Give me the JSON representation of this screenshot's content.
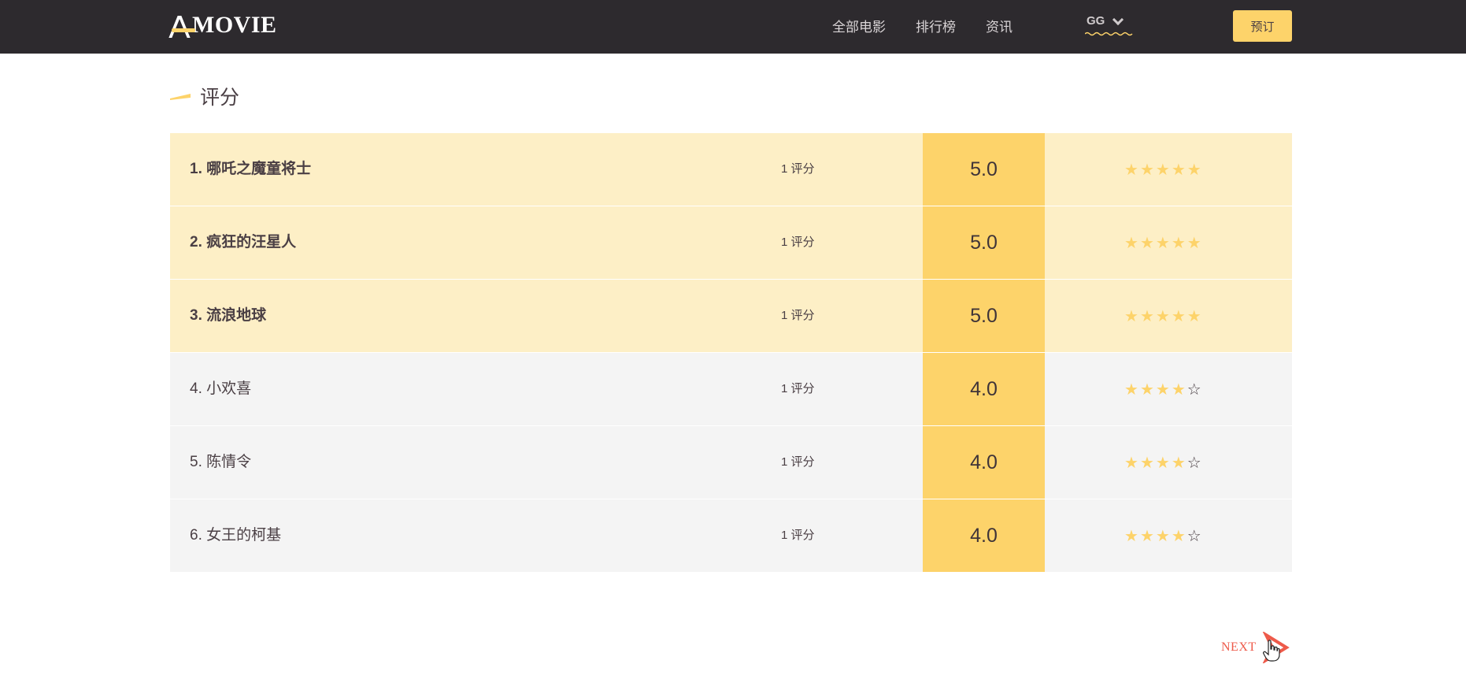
{
  "header": {
    "logo_text": "MOVIE",
    "nav": [
      "全部电影",
      "排行榜",
      "资讯"
    ],
    "user_name": "GG",
    "book_label": "预订"
  },
  "section": {
    "title": "评分"
  },
  "ranking": [
    {
      "name": "1. 哪吒之魔童将士",
      "count": "1 评分",
      "score": "5.0",
      "stars": 5
    },
    {
      "name": "2. 疯狂的汪星人",
      "count": "1 评分",
      "score": "5.0",
      "stars": 5
    },
    {
      "name": "3. 流浪地球",
      "count": "1 评分",
      "score": "5.0",
      "stars": 5
    },
    {
      "name": "4. 小欢喜",
      "count": "1 评分",
      "score": "4.0",
      "stars": 4
    },
    {
      "name": "5. 陈情令",
      "count": "1 评分",
      "score": "4.0",
      "stars": 4
    },
    {
      "name": "6. 女王的柯基",
      "count": "1 评分",
      "score": "4.0",
      "stars": 4
    }
  ],
  "pager": {
    "next_label": "NEXT"
  },
  "colors": {
    "accent": "#fdd36a",
    "header_bg": "#2d2a2e",
    "top_row_bg": "#fdefc6",
    "row_bg": "#f4f4f4",
    "next_color": "#ee5a4a"
  }
}
